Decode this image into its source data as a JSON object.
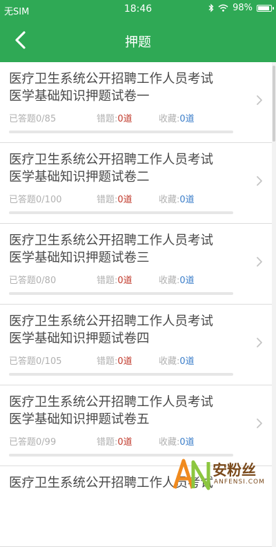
{
  "status_bar": {
    "carrier": "无SIM",
    "time": "18:46",
    "battery": "98%",
    "battery_level": 0.98
  },
  "nav": {
    "title": "押题"
  },
  "labels": {
    "answered": "已答题",
    "wrong": "错题:",
    "fav": "收藏:"
  },
  "items": [
    {
      "title_line1": "医疗卫生系统公开招聘工作人员考试",
      "title_line2": "医学基础知识押题试卷一",
      "answered": "0/85",
      "wrong": "0道",
      "fav": "0道",
      "progress": 0
    },
    {
      "title_line1": "医疗卫生系统公开招聘工作人员考试",
      "title_line2": "医学基础知识押题试卷二",
      "answered": "0/100",
      "wrong": "0道",
      "fav": "0道",
      "progress": 0
    },
    {
      "title_line1": "医疗卫生系统公开招聘工作人员考试",
      "title_line2": "医学基础知识押题试卷三",
      "answered": "0/80",
      "wrong": "0道",
      "fav": "0道",
      "progress": 0
    },
    {
      "title_line1": "医疗卫生系统公开招聘工作人员考试",
      "title_line2": "医学基础知识押题试卷四",
      "answered": "0/105",
      "wrong": "0道",
      "fav": "0道",
      "progress": 0
    },
    {
      "title_line1": "医疗卫生系统公开招聘工作人员考试",
      "title_line2": "医学基础知识押题试卷五",
      "answered": "0/99",
      "wrong": "0道",
      "fav": "0道",
      "progress": 0
    },
    {
      "title_line1": "医疗卫生系统公开招聘工作人员考试",
      "title_line2": "",
      "answered": "",
      "wrong": "",
      "fav": "",
      "progress": 0
    }
  ],
  "watermark": {
    "text": "安粉丝",
    "sub": "ANFENSI.COM"
  },
  "colors": {
    "primary": "#2fa955",
    "wrong": "#c0392b",
    "fav": "#3a7dc9"
  }
}
